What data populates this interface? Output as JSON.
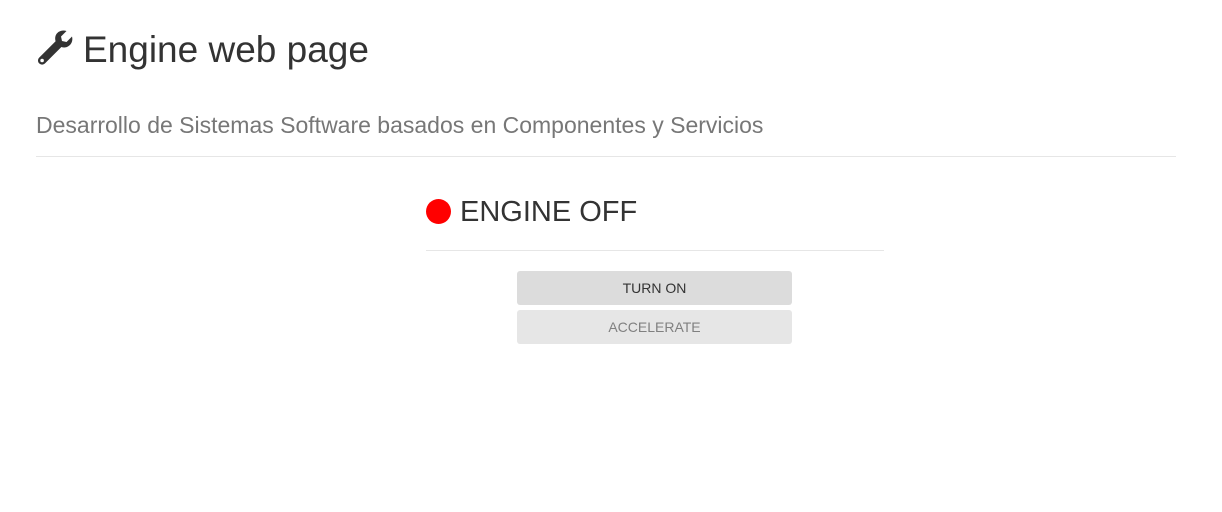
{
  "header": {
    "icon": "wrench-icon",
    "title": "Engine web page"
  },
  "subtitle": "Desarrollo de Sistemas Software basados en Componentes y Servicios",
  "engine": {
    "status_text": "ENGINE OFF",
    "status_color": "#ff0000"
  },
  "controls": {
    "turn_on_label": "TURN ON",
    "accelerate_label": "ACCELERATE"
  }
}
